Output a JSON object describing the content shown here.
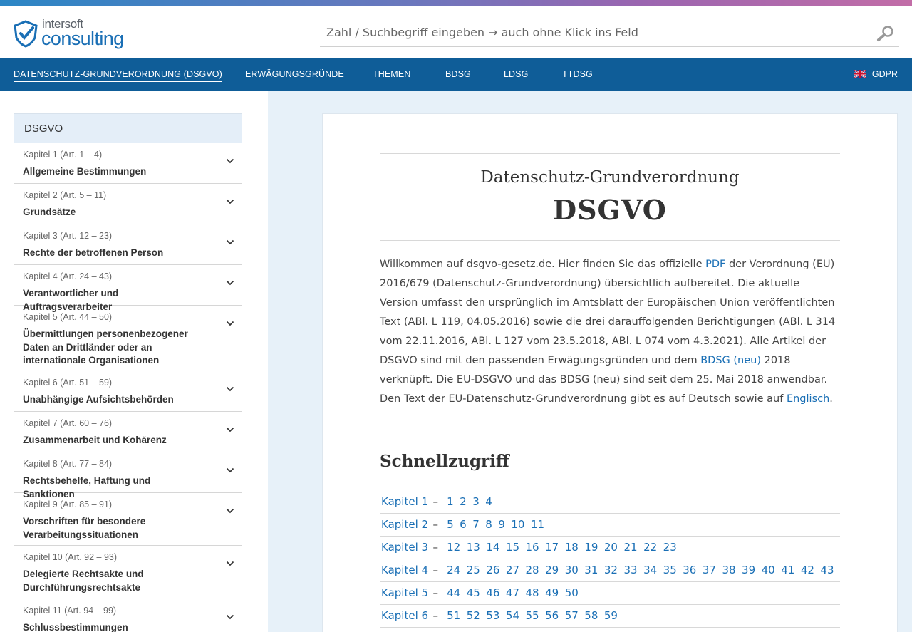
{
  "header": {
    "logo_line1": "intersoft",
    "logo_line2": "consulting",
    "search_placeholder": "Zahl / Suchbegriff eingeben → auch ohne Klick ins Feld"
  },
  "nav": {
    "items": [
      {
        "label": "DATENSCHUTZ-GRUNDVERORDNUNG (DSGVO)",
        "active": true
      },
      {
        "label": "ERWÄGUNGSGRÜNDE"
      },
      {
        "label": "THEMEN"
      },
      {
        "label": "BDSG"
      },
      {
        "label": "LDSG"
      },
      {
        "label": "TTDSG"
      }
    ],
    "lang": "GDPR"
  },
  "sidebar": {
    "title": "DSGVO",
    "chapters": [
      {
        "sub": "Kapitel 1 (Art. 1 – 4)",
        "name": "Allgemeine Bestimmungen"
      },
      {
        "sub": "Kapitel 2 (Art. 5 – 11)",
        "name": "Grundsätze"
      },
      {
        "sub": "Kapitel 3 (Art. 12 – 23)",
        "name": "Rechte der betroffenen Person"
      },
      {
        "sub": "Kapitel 4 (Art. 24 – 43)",
        "name": "Verantwortlicher und Auftragsverarbeiter"
      },
      {
        "sub": "Kapitel 5 (Art. 44 – 50)",
        "name": "Übermittlungen personenbezogener Daten an Drittländer oder an internationale Organisationen"
      },
      {
        "sub": "Kapitel 6 (Art. 51 – 59)",
        "name": "Unabhängige Aufsichtsbehörden"
      },
      {
        "sub": "Kapitel 7 (Art. 60 – 76)",
        "name": "Zusammenarbeit und Kohärenz"
      },
      {
        "sub": "Kapitel 8 (Art. 77 – 84)",
        "name": "Rechtsbehelfe, Haftung und Sanktionen"
      },
      {
        "sub": "Kapitel 9 (Art. 85 – 91)",
        "name": "Vorschriften für besondere Verarbeitungssituationen"
      },
      {
        "sub": "Kapitel 10 (Art. 92 – 93)",
        "name": "Delegierte Rechtsakte und Durchführungsrechtsakte"
      },
      {
        "sub": "Kapitel 11 (Art. 94 – 99)",
        "name": "Schlussbestimmungen"
      }
    ]
  },
  "main": {
    "subtitle": "Datenschutz-Grundverordnung",
    "title": "DSGVO",
    "intro": {
      "t1": "Willkommen auf dsgvo-gesetz.de. Hier finden Sie das offizielle ",
      "pdf": "PDF",
      "t2": " der Verordnung (EU) 2016/679 (Datenschutz-Grundverordnung) übersichtlich aufbereitet. Die aktuelle Version umfasst den ursprünglich im Amtsblatt der Europäischen Union veröffentlichten Text (ABl. L 119, 04.05.2016) sowie die drei darauffolgenden Berichtigungen (ABl. L 314 vom 22.11.2016, ABl. L 127 vom 23.5.2018, ABl. L 074 vom 4.3.2021). Alle Artikel der DSGVO sind mit den passenden Erwägungsgründen und dem ",
      "bdsg": "BDSG (neu)",
      "t3": " 2018 verknüpft. Die EU-DSGVO und das BDSG (neu) sind seit dem 25. Mai 2018 anwendbar. Den Text der EU-Datenschutz-Grundverordnung gibt es auf Deutsch sowie auf ",
      "en": "Englisch",
      "t4": "."
    },
    "quick_title": "Schnellzugriff",
    "quick_dash": "–",
    "quick": [
      {
        "label": "Kapitel 1",
        "articles": [
          "1",
          "2",
          "3",
          "4"
        ]
      },
      {
        "label": "Kapitel 2",
        "articles": [
          "5",
          "6",
          "7",
          "8",
          "9",
          "10",
          "11"
        ]
      },
      {
        "label": "Kapitel 3",
        "articles": [
          "12",
          "13",
          "14",
          "15",
          "16",
          "17",
          "18",
          "19",
          "20",
          "21",
          "22",
          "23"
        ]
      },
      {
        "label": "Kapitel 4",
        "articles": [
          "24",
          "25",
          "26",
          "27",
          "28",
          "29",
          "30",
          "31",
          "32",
          "33",
          "34",
          "35",
          "36",
          "37",
          "38",
          "39",
          "40",
          "41",
          "42",
          "43"
        ]
      },
      {
        "label": "Kapitel 5",
        "articles": [
          "44",
          "45",
          "46",
          "47",
          "48",
          "49",
          "50"
        ]
      },
      {
        "label": "Kapitel 6",
        "articles": [
          "51",
          "52",
          "53",
          "54",
          "55",
          "56",
          "57",
          "58",
          "59"
        ]
      }
    ]
  }
}
